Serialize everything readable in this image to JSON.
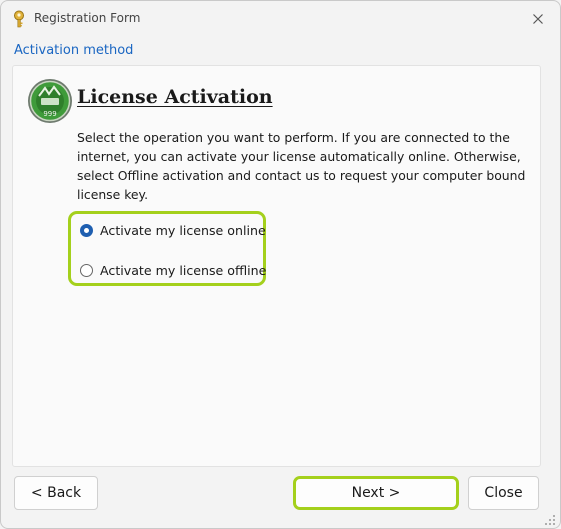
{
  "window": {
    "title": "Registration Form",
    "section_label": "Activation method"
  },
  "content": {
    "heading": "License Activation",
    "description": "Select the operation you want to perform. If you are connected to the internet, you can activate your license automatically online. Otherwise, select Offline activation and contact us to request your computer bound license key.",
    "logo_text": "999",
    "options": [
      {
        "label": "Activate my license online",
        "selected": true
      },
      {
        "label": "Activate my license offline",
        "selected": false
      }
    ]
  },
  "buttons": {
    "back": "< Back",
    "next": "Next >",
    "close": "Close"
  },
  "colors": {
    "link": "#1a66c2",
    "highlight": "#a4d01c",
    "radio_selected": "#1f5fb0"
  },
  "icons": {
    "app": "key-icon",
    "close": "close-icon",
    "logo": "license-seal-icon",
    "grip": "resize-grip-icon"
  }
}
